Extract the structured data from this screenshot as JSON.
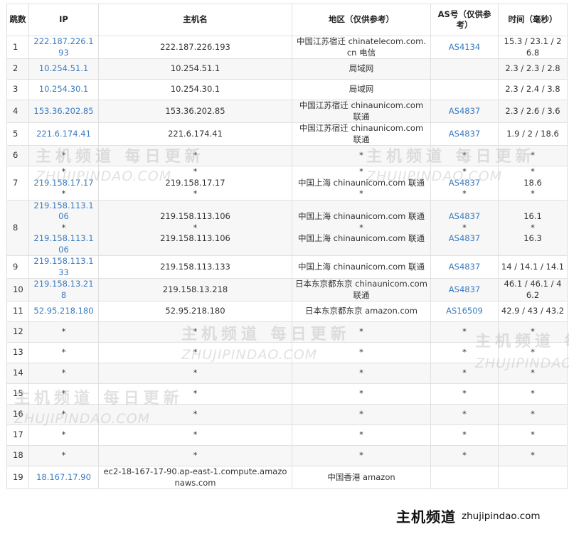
{
  "headers": {
    "hop": "跳数",
    "ip": "IP",
    "host": "主机名",
    "region": "地区（仅供参考）",
    "as": "AS号（仅供参考）",
    "time": "时间（毫秒）"
  },
  "rows": [
    {
      "hop": "1",
      "ip": [
        "222.187.226.193"
      ],
      "host": [
        "222.187.226.193"
      ],
      "region": [
        "中国江苏宿迁 chinatelecom.com.cn 电信"
      ],
      "as": [
        "AS4134"
      ],
      "time": [
        "15.3 / 23.1 / 26.8"
      ]
    },
    {
      "hop": "2",
      "ip": [
        "10.254.51.1"
      ],
      "host": [
        "10.254.51.1"
      ],
      "region": [
        "局域网"
      ],
      "as": [
        ""
      ],
      "time": [
        "2.3 / 2.3 / 2.8"
      ]
    },
    {
      "hop": "3",
      "ip": [
        "10.254.30.1"
      ],
      "host": [
        "10.254.30.1"
      ],
      "region": [
        "局域网"
      ],
      "as": [
        ""
      ],
      "time": [
        "2.3 / 2.4 / 3.8"
      ]
    },
    {
      "hop": "4",
      "ip": [
        "153.36.202.85"
      ],
      "host": [
        "153.36.202.85"
      ],
      "region": [
        "中国江苏宿迁 chinaunicom.com 联通"
      ],
      "as": [
        "AS4837"
      ],
      "time": [
        "2.3 / 2.6 / 3.6"
      ]
    },
    {
      "hop": "5",
      "ip": [
        "221.6.174.41"
      ],
      "host": [
        "221.6.174.41"
      ],
      "region": [
        "中国江苏宿迁 chinaunicom.com 联通"
      ],
      "as": [
        "AS4837"
      ],
      "time": [
        "1.9 / 2 / 18.6"
      ]
    },
    {
      "hop": "6",
      "ip": [
        "*"
      ],
      "host": [
        "*"
      ],
      "region": [
        "*"
      ],
      "as": [
        "*"
      ],
      "time": [
        "*"
      ]
    },
    {
      "hop": "7",
      "ip": [
        "*",
        "219.158.17.17",
        "*"
      ],
      "host": [
        "*",
        "219.158.17.17",
        "*"
      ],
      "region": [
        "*",
        "中国上海 chinaunicom.com 联通",
        "*"
      ],
      "as": [
        "*",
        "AS4837",
        "*"
      ],
      "time": [
        "*",
        "18.6",
        "*"
      ]
    },
    {
      "hop": "8",
      "ip": [
        "219.158.113.106",
        "*",
        "219.158.113.106"
      ],
      "host": [
        "219.158.113.106",
        "*",
        "219.158.113.106"
      ],
      "region": [
        "中国上海 chinaunicom.com 联通",
        "*",
        "中国上海 chinaunicom.com 联通"
      ],
      "as": [
        "AS4837",
        "*",
        "AS4837"
      ],
      "time": [
        "16.1",
        "*",
        "16.3"
      ]
    },
    {
      "hop": "9",
      "ip": [
        "219.158.113.133"
      ],
      "host": [
        "219.158.113.133"
      ],
      "region": [
        "中国上海 chinaunicom.com 联通"
      ],
      "as": [
        "AS4837"
      ],
      "time": [
        "14 / 14.1 / 14.1"
      ]
    },
    {
      "hop": "10",
      "ip": [
        "219.158.13.218"
      ],
      "host": [
        "219.158.13.218"
      ],
      "region": [
        "日本东京都东京 chinaunicom.com 联通"
      ],
      "as": [
        "AS4837"
      ],
      "time": [
        "46.1 / 46.1 / 46.2"
      ]
    },
    {
      "hop": "11",
      "ip": [
        "52.95.218.180"
      ],
      "host": [
        "52.95.218.180"
      ],
      "region": [
        "日本东京都东京 amazon.com"
      ],
      "as": [
        "AS16509"
      ],
      "time": [
        "42.9 / 43 / 43.2"
      ]
    },
    {
      "hop": "12",
      "ip": [
        "*"
      ],
      "host": [
        "*"
      ],
      "region": [
        "*"
      ],
      "as": [
        "*"
      ],
      "time": [
        "*"
      ]
    },
    {
      "hop": "13",
      "ip": [
        "*"
      ],
      "host": [
        "*"
      ],
      "region": [
        "*"
      ],
      "as": [
        "*"
      ],
      "time": [
        "*"
      ]
    },
    {
      "hop": "14",
      "ip": [
        "*"
      ],
      "host": [
        "*"
      ],
      "region": [
        "*"
      ],
      "as": [
        "*"
      ],
      "time": [
        "*"
      ]
    },
    {
      "hop": "15",
      "ip": [
        "*"
      ],
      "host": [
        "*"
      ],
      "region": [
        "*"
      ],
      "as": [
        "*"
      ],
      "time": [
        "*"
      ]
    },
    {
      "hop": "16",
      "ip": [
        "*"
      ],
      "host": [
        "*"
      ],
      "region": [
        "*"
      ],
      "as": [
        "*"
      ],
      "time": [
        "*"
      ]
    },
    {
      "hop": "17",
      "ip": [
        "*"
      ],
      "host": [
        "*"
      ],
      "region": [
        "*"
      ],
      "as": [
        "*"
      ],
      "time": [
        "*"
      ]
    },
    {
      "hop": "18",
      "ip": [
        "*"
      ],
      "host": [
        "*"
      ],
      "region": [
        "*"
      ],
      "as": [
        "*"
      ],
      "time": [
        "*"
      ]
    },
    {
      "hop": "19",
      "ip": [
        "18.167.17.90"
      ],
      "host": [
        "ec2-18-167-17-90.ap-east-1.compute.amazonaws.com"
      ],
      "region": [
        "中国香港 amazon"
      ],
      "as": [
        ""
      ],
      "time": [
        ""
      ]
    }
  ],
  "watermark": {
    "cn": "主机频道 每日更新",
    "en": "ZHUJIPINDAO.COM"
  },
  "brand": {
    "name": "主机频道",
    "url": "zhujipindao.com"
  },
  "colors": {
    "link": "#3a7bbf",
    "stripe": "#f7f7f7",
    "border": "#e0e0e0"
  }
}
